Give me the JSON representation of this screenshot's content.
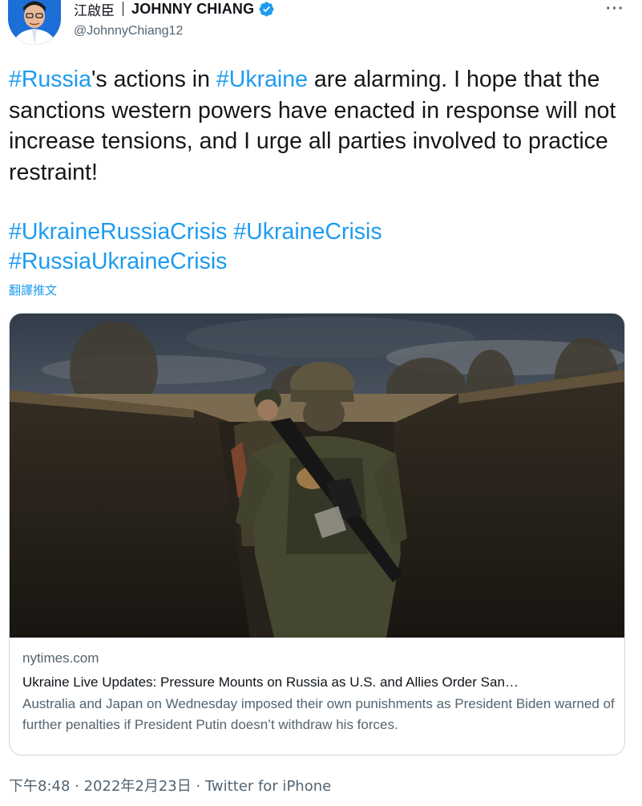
{
  "author": {
    "display_name_cjk": "江啟臣",
    "display_name": "JOHNNY CHIANG",
    "handle": "@JohnnyChiang12",
    "verified_icon": "verified-badge-icon",
    "more_label": "···"
  },
  "tweet": {
    "text_parts": [
      {
        "type": "tag",
        "text": "#Russia"
      },
      {
        "type": "text",
        "text": "'s actions in "
      },
      {
        "type": "tag",
        "text": "#Ukraine"
      },
      {
        "type": "text",
        "text": " are alarming. I hope that the sanctions western powers have enacted in response will not increase tensions, and I urge all parties involved to practice restraint!"
      }
    ],
    "hashtags": [
      "#UkraineRussiaCrisis",
      "#UkraineCrisis",
      "#RussiaUkraineCrisis"
    ],
    "translate_label": "翻譯推文"
  },
  "card": {
    "image_name": "soldiers-in-trench-photo",
    "domain": "nytimes.com",
    "title": "Ukraine Live Updates: Pressure Mounts on Russia as U.S. and Allies Order San…",
    "description": "Australia and Japan on Wednesday imposed their own punishments as President Biden warned of further penalties if President Putin doesn’t withdraw his forces."
  },
  "meta": {
    "timestamp": "下午8:48 · 2022年2月23日 · Twitter for iPhone"
  },
  "colors": {
    "link": "#1d9bf0",
    "secondary_text": "#536471",
    "border": "#cfd9de"
  }
}
